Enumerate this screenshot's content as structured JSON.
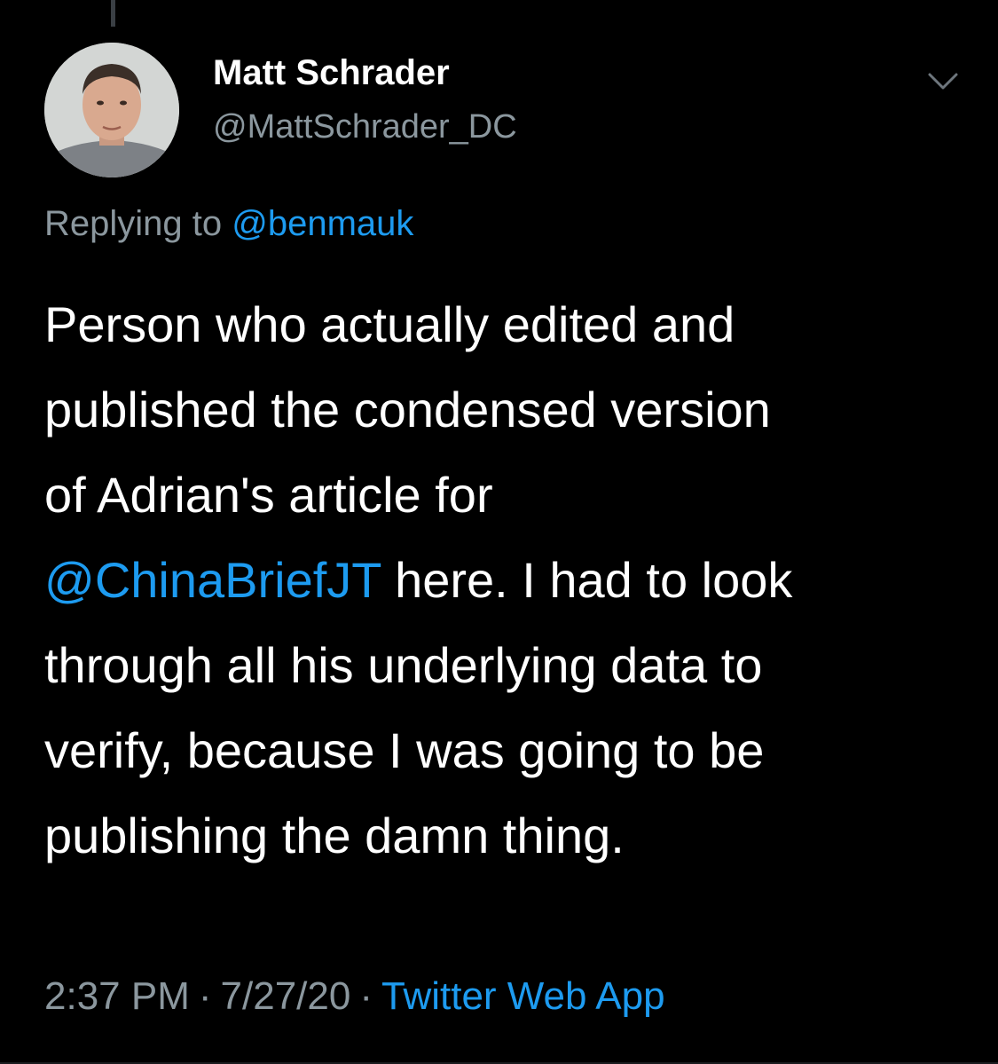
{
  "author": {
    "name": "Matt Schrader",
    "handle": "@MattSchrader_DC"
  },
  "reply": {
    "prefix": "Replying to ",
    "mention": "@benmauk"
  },
  "tweet": {
    "line1": "Person who actually edited and",
    "line2": "published the condensed version",
    "line3": "of Adrian's article for",
    "line4_mention": "@ChinaBriefJT",
    "line4_rest": " here. I had to look",
    "line5": "through all his underlying data to",
    "line6": "verify, because I was going to be",
    "line7": "publishing the damn thing."
  },
  "meta": {
    "time": "2:37 PM",
    "separator": "·",
    "date": "7/27/20",
    "source": "Twitter Web App"
  },
  "icons": {
    "menu": "chevron-down-icon",
    "avatar": "avatar"
  },
  "colors": {
    "background": "#000000",
    "text": "#ffffff",
    "secondary": "#8b979e",
    "link": "#1d9bf0"
  }
}
